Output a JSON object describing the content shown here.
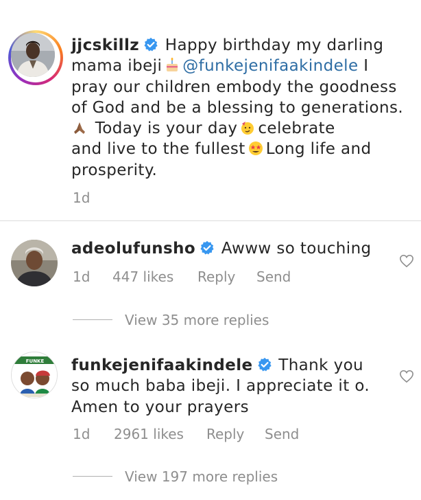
{
  "caption": {
    "username": "jjcskillz",
    "text_line1": "Happy birthday my darling",
    "text_line2_pre": "mama ibeji",
    "mention": "@funkejenifaakindele",
    "text_line2_post": "I",
    "text_line3": "pray our children embody the goodness",
    "text_line4": "of God and be a blessing to generations.",
    "text_line5": "Today is your day",
    "text_line5_post": "celebrate",
    "text_line6_pre": "and live to the fullest",
    "text_line6_post": "Long life and",
    "text_line7": "prosperity.",
    "time": "1d"
  },
  "comments": [
    {
      "username": "adeolufunsho",
      "text_line1": "Awww so touching",
      "time": "1d",
      "likes": "447 likes",
      "reply": "Reply",
      "send": "Send",
      "view_replies": "View 35 more replies"
    },
    {
      "username": "funkejenifaakindele",
      "text_line1": "Thank you",
      "text_line2": "so much baba ibeji. I appreciate it o.",
      "text_line3": "Amen to your prayers",
      "time": "1d",
      "likes": "2961 likes",
      "reply": "Reply",
      "send": "Send",
      "view_replies": "View 197 more replies",
      "avatar_banner": "FUNKE"
    }
  ],
  "icons": {
    "verified": "verified-badge-icon",
    "heart": "heart-outline-icon",
    "emoji_cake": "birthday-cake-emoji",
    "emoji_pray": "folded-hands-emoji",
    "emoji_party": "partying-face-emoji",
    "emoji_star": "star-struck-emoji"
  },
  "colors": {
    "verified": "#3897f0",
    "mention": "#2e6da4",
    "meta": "#8e8e8e",
    "text": "#262626"
  }
}
